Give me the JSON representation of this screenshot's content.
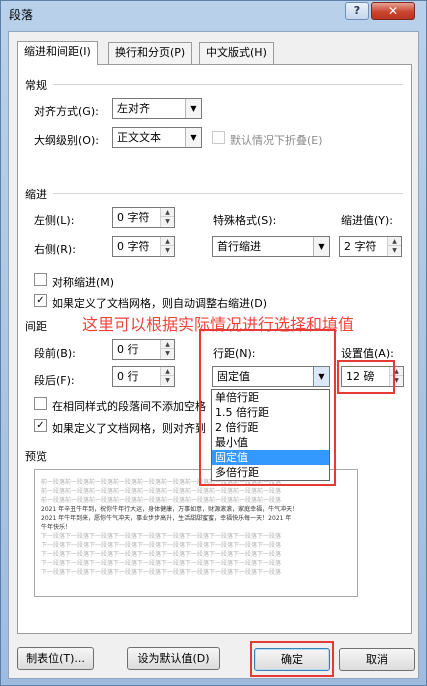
{
  "window": {
    "title": "段落",
    "help": "?",
    "close": "✕"
  },
  "tabs": [
    {
      "label": "缩进和间距(I)"
    },
    {
      "label": "换行和分页(P)"
    },
    {
      "label": "中文版式(H)"
    }
  ],
  "general": {
    "title": "常规",
    "alignment_label": "对齐方式(G):",
    "alignment_value": "左对齐",
    "outline_label": "大纲级别(O):",
    "outline_value": "正文文本",
    "collapse_label": "默认情况下折叠(E)"
  },
  "indent": {
    "title": "缩进",
    "left_label": "左侧(L):",
    "left_value": "0 字符",
    "right_label": "右侧(R):",
    "right_value": "0 字符",
    "special_label": "特殊格式(S):",
    "special_value": "首行缩进",
    "by_label": "缩进值(Y):",
    "by_value": "2 字符",
    "mirror_label": "对称缩进(M)",
    "auto_adjust_label": "如果定义了文档网格，则自动调整右缩进(D)"
  },
  "spacing": {
    "title": "间距",
    "before_label": "段前(B):",
    "before_value": "0 行",
    "after_label": "段后(F):",
    "after_value": "0 行",
    "line_spacing_label": "行距(N):",
    "line_spacing_value": "固定值",
    "at_label": "设置值(A):",
    "at_value": "12 磅",
    "no_space_label": "在相同样式的段落间不添加空格",
    "snap_grid_label": "如果定义了文档网格，则对齐到"
  },
  "line_spacing_options": [
    "单倍行距",
    "1.5 倍行距",
    "2 倍行距",
    "最小值",
    "固定值",
    "多倍行距"
  ],
  "annotation": {
    "text": "这里可以根据实际情况进行选择和填值"
  },
  "preview": {
    "title": "预览",
    "prev_line": "前一段落前一段落前一段落前一段落前一段落前一段落前一段落前一段落前一段落前一段落",
    "sample_lines": [
      "2021 年辛丑牛年到，祝你牛年行大运，身体健康，万事如意，财源滚滚，家庭幸福，牛气冲天！",
      "2021 年牛年到来，愿你牛气冲天，事业步步高升，生活甜甜蜜蜜，幸福快乐每一天！2021 年",
      "牛年快乐！"
    ],
    "next_line": "下一段落下一段落下一段落下一段落下一段落下一段落下一段落下一段落下一段落下一段落"
  },
  "buttons": {
    "tabs": "制表位(T)...",
    "set_default": "设为默认值(D)",
    "ok": "确定",
    "cancel": "取消"
  }
}
